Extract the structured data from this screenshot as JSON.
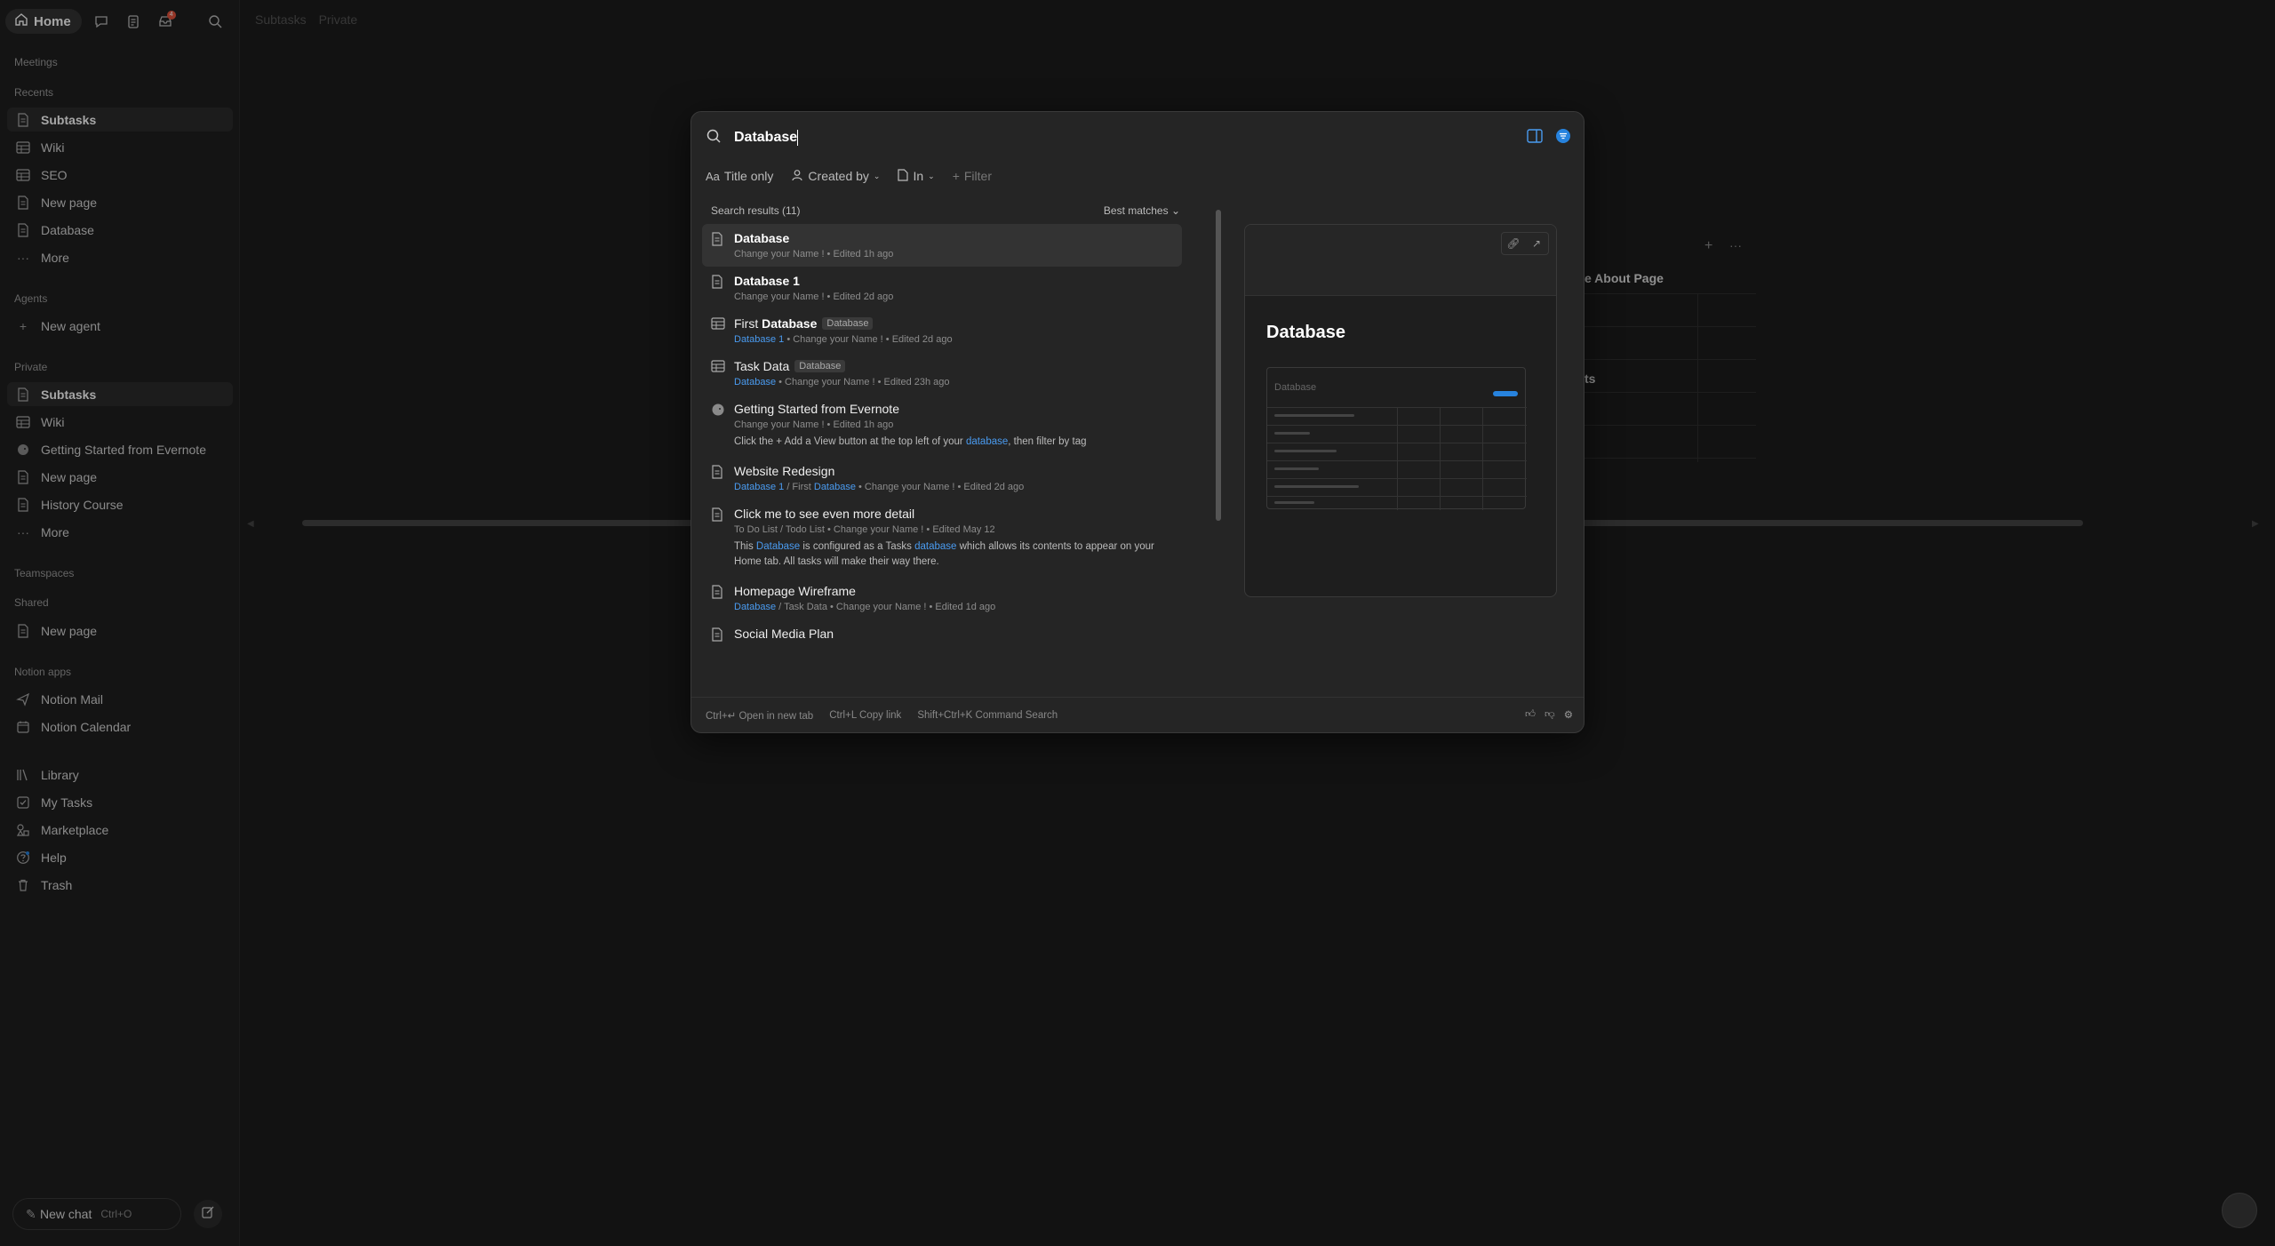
{
  "topbar": {
    "home_label": "Home",
    "inbox_badge": "4"
  },
  "sidebar": {
    "sections": {
      "meetings": "Meetings",
      "recents": "Recents",
      "agents": "Agents",
      "private": "Private",
      "teamspaces": "Teamspaces",
      "shared": "Shared",
      "notion_apps": "Notion apps"
    },
    "recents": [
      "Subtasks",
      "Wiki",
      "SEO",
      "New page",
      "Database",
      "More"
    ],
    "agents": [
      "New agent"
    ],
    "private": [
      "Subtasks",
      "Wiki",
      "Getting Started from Evernote",
      "New page",
      "History Course",
      "More"
    ],
    "shared": [
      "New page"
    ],
    "apps": [
      "Notion Mail",
      "Notion Calendar"
    ],
    "bottom": [
      "Library",
      "My Tasks",
      "Marketplace",
      "Help",
      "Trash"
    ],
    "new_chat": {
      "label": "New chat",
      "shortcut": "Ctrl+O"
    }
  },
  "page": {
    "breadcrumb": [
      "Subtasks",
      "Private"
    ],
    "bg_table_header": "e About Page",
    "bg_table_cell": "ts"
  },
  "search": {
    "query": "Database",
    "filters": [
      "Title only",
      "Created by",
      "In",
      "Filter"
    ],
    "results_label": "Search results (11)",
    "sort_label": "Best matches",
    "results": [
      {
        "title": "Database",
        "icon": "page-icon",
        "meta": "Change your Name ! • Edited 1h ago"
      },
      {
        "title": "Database 1",
        "icon": "page-icon",
        "meta": "Change your Name ! • Edited 2d ago"
      },
      {
        "title_prefix": "First ",
        "title": "Database",
        "tag": "Database",
        "icon": "table-icon",
        "meta_hl": "Database 1",
        "meta": " • Change your Name ! • Edited 2d ago"
      },
      {
        "title": "Task Data",
        "tag": "Database",
        "icon": "table-icon",
        "meta_hl": "Database",
        "meta": " • Change your Name ! • Edited 23h ago"
      },
      {
        "title": "Getting Started from Evernote",
        "icon": "elephant-icon",
        "meta": "Change your Name ! • Edited 1h ago",
        "snippet_a": "Click the + Add a View button at the top left of your ",
        "snippet_hl": "database",
        "snippet_b": ", then filter by tag"
      },
      {
        "title": "Website Redesign",
        "icon": "page-icon",
        "meta_hl": "Database 1",
        "meta_mid": " / First ",
        "meta_hl2": "Database",
        "meta": " • Change your Name ! • Edited 2d ago"
      },
      {
        "title": "Click me to see even more detail",
        "icon": "page-icon",
        "meta": "To Do List / Todo List • Change your Name ! • Edited May 12",
        "snippet_a": "This ",
        "snippet_hl": "Database",
        "snippet_b": " is configured as a Tasks ",
        "snippet_hl2": "database",
        "snippet_c": " which allows its contents to appear on your Home tab. All tasks will make their way there."
      },
      {
        "title": "Homepage Wireframe",
        "icon": "page-icon",
        "meta_hl": "Database",
        "meta": " / Task Data • Change your Name ! • Edited 1d ago"
      },
      {
        "title": "Social Media Plan",
        "icon": "page-icon"
      }
    ],
    "preview": {
      "title": "Database",
      "mini_label": "Database"
    },
    "footer": [
      {
        "key": "Ctrl+↵",
        "label": "Open in new tab"
      },
      {
        "key": "Ctrl+L",
        "label": "Copy link"
      },
      {
        "key": "Shift+Ctrl+K",
        "label": "Command Search"
      }
    ]
  },
  "colors": {
    "accent": "#2783de",
    "highlight": "#4a9bf0",
    "background": "#1c1c1c"
  }
}
